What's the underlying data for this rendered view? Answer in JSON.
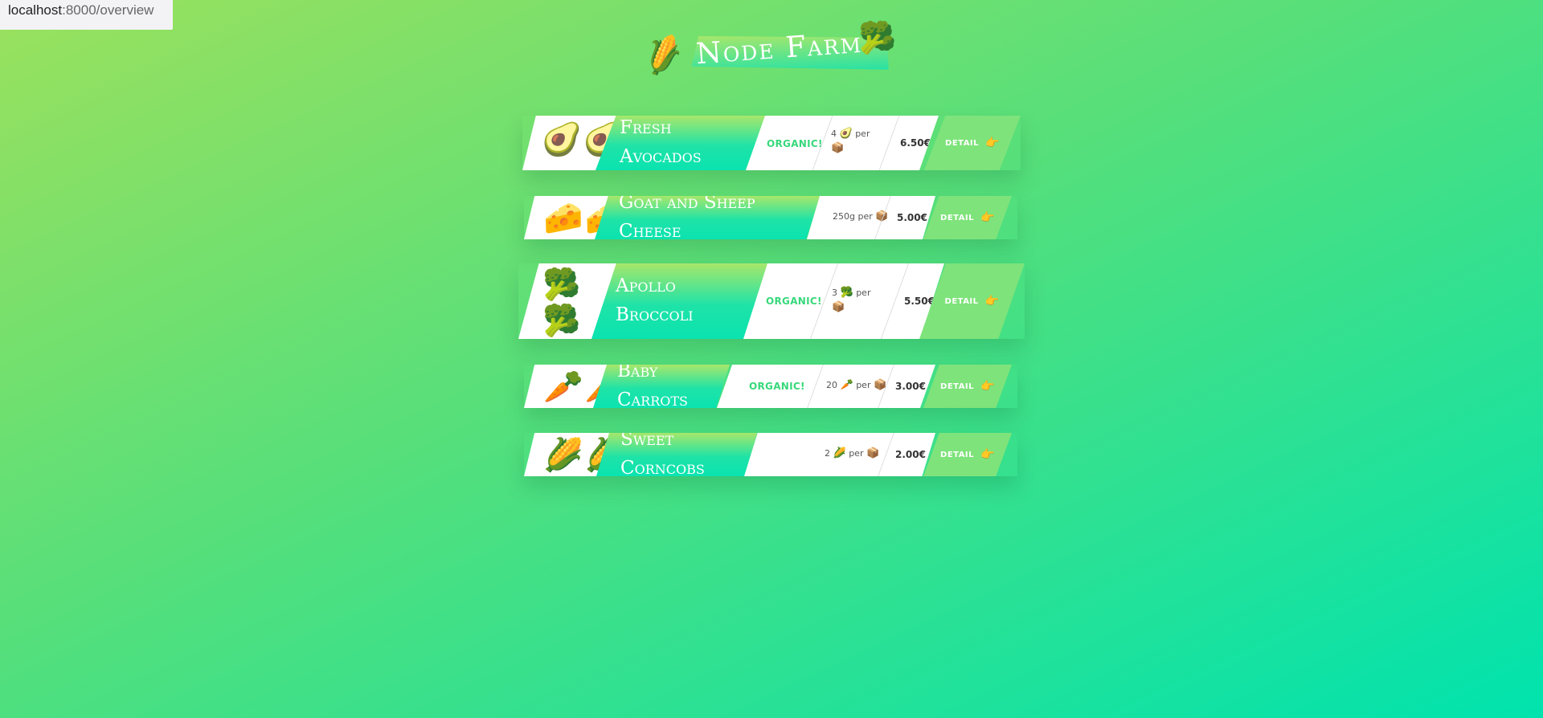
{
  "browser": {
    "host": "localhost",
    "path": ":8000/overview"
  },
  "header": {
    "title": "Node Farm",
    "left_icon": "🌽",
    "right_icon": "🥦"
  },
  "products": [
    {
      "name_line1": "Fresh",
      "name_line2": "Avocados",
      "icons": [
        "🥑",
        "🥑"
      ],
      "organic": "ORGANIC!",
      "qty_num": "4",
      "qty_icon": "🥑",
      "qty_per": "per",
      "qty_unit_icon": "📦",
      "price": "6.50€",
      "detail": "DETAIL",
      "detail_icon": "👉"
    },
    {
      "name_line1": "Goat and Sheep Cheese",
      "icons": [
        "🧀",
        "🧀"
      ],
      "qty_num": "250g",
      "qty_per": "per",
      "qty_unit_icon": "📦",
      "price": "5.00€",
      "detail": "DETAIL",
      "detail_icon": "👉"
    },
    {
      "name_line1": "Apollo",
      "name_line2": "Broccoli",
      "icons": [
        "🥦",
        "🥦"
      ],
      "organic": "ORGANIC!",
      "qty_num": "3",
      "qty_icon": "🥦",
      "qty_per": "per",
      "qty_unit_icon": "📦",
      "price": "5.50€",
      "detail": "DETAIL",
      "detail_icon": "👉"
    },
    {
      "name_line1": "Baby Carrots",
      "icons": [
        "🥕",
        "🥕"
      ],
      "organic": "ORGANIC!",
      "qty_num": "20",
      "qty_icon": "🥕",
      "qty_per": "per",
      "qty_unit_icon": "📦",
      "price": "3.00€",
      "detail": "DETAIL",
      "detail_icon": "👉"
    },
    {
      "name_line1": "Sweet Corncobs",
      "icons": [
        "🌽",
        "🌽"
      ],
      "qty_num": "2",
      "qty_icon": "🌽",
      "qty_per": "per",
      "qty_unit_icon": "📦",
      "price": "2.00€",
      "detail": "DETAIL",
      "detail_icon": "👉"
    }
  ]
}
